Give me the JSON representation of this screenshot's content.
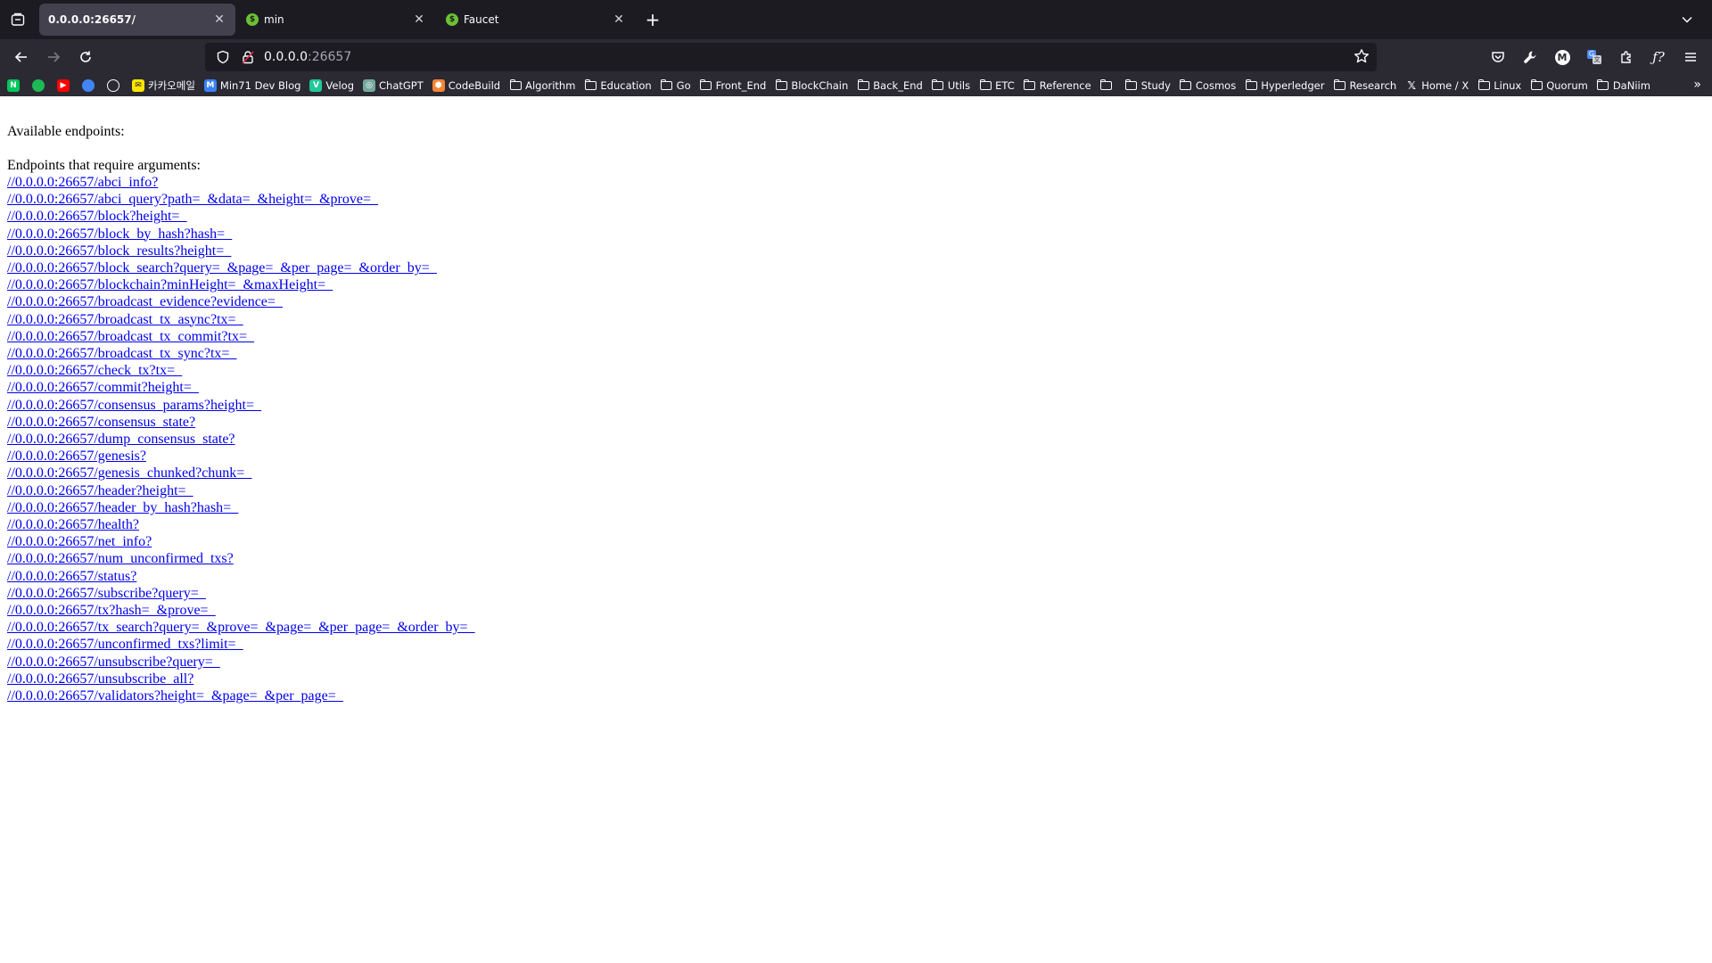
{
  "browser": {
    "tabs": [
      {
        "title": "0.0.0.0:26657/",
        "active": true
      },
      {
        "title": "min",
        "active": false
      },
      {
        "title": "Faucet",
        "active": false
      }
    ],
    "url": {
      "host": "0.0.0.0",
      "port": ":26657"
    },
    "bookmarks": [
      {
        "label": "",
        "icon": "naver-icon",
        "color": "#03c75a",
        "glyph": "N"
      },
      {
        "label": "",
        "icon": "spotify-icon",
        "color": "#1db954",
        "glyph": ""
      },
      {
        "label": "",
        "icon": "youtube-icon",
        "color": "#ff0000",
        "glyph": "▶"
      },
      {
        "label": "",
        "icon": "chrome-icon",
        "color": "#4285f4",
        "glyph": ""
      },
      {
        "label": "",
        "icon": "github-icon",
        "color": "#ffffff",
        "glyph": ""
      },
      {
        "label": "카카오메일",
        "icon": "kakao-mail-icon",
        "color": "#fee500",
        "glyph": "✉"
      },
      {
        "label": "Min71 Dev Blog",
        "icon": "blog-icon",
        "color": "#3b82f6",
        "glyph": "M"
      },
      {
        "label": "Velog",
        "icon": "velog-icon",
        "color": "#20c997",
        "glyph": "V"
      },
      {
        "label": "ChatGPT",
        "icon": "chatgpt-icon",
        "color": "#74aa9c",
        "glyph": "◎"
      },
      {
        "label": "CodeBuild",
        "icon": "codebuild-icon",
        "color": "#f58536",
        "glyph": "⬢"
      },
      {
        "label": "Algorithm",
        "icon": "folder-icon"
      },
      {
        "label": "Education",
        "icon": "folder-icon"
      },
      {
        "label": "Go",
        "icon": "folder-icon"
      },
      {
        "label": "Front_End",
        "icon": "folder-icon"
      },
      {
        "label": "BlockChain",
        "icon": "folder-icon"
      },
      {
        "label": "Back_End",
        "icon": "folder-icon"
      },
      {
        "label": "Utils",
        "icon": "folder-icon"
      },
      {
        "label": "ETC",
        "icon": "folder-icon"
      },
      {
        "label": "Reference",
        "icon": "folder-icon"
      },
      {
        "label": "",
        "icon": "folder-icon"
      },
      {
        "label": "Study",
        "icon": "folder-icon"
      },
      {
        "label": "Cosmos",
        "icon": "folder-icon"
      },
      {
        "label": "Hyperledger",
        "icon": "folder-icon"
      },
      {
        "label": "Research",
        "icon": "folder-icon"
      },
      {
        "label": "Home / X",
        "icon": "x-icon",
        "color": "#ffffff",
        "glyph": "𝕏"
      },
      {
        "label": "Linux",
        "icon": "folder-icon"
      },
      {
        "label": "Quorum",
        "icon": "folder-icon"
      },
      {
        "label": "DaNiim",
        "icon": "folder-icon"
      }
    ]
  },
  "page": {
    "available_label": "Available endpoints:",
    "require_label": "Endpoints that require arguments:",
    "endpoints": [
      "//0.0.0.0:26657/abci_info?",
      "//0.0.0.0:26657/abci_query?path=_&data=_&height=_&prove=_",
      "//0.0.0.0:26657/block?height=_",
      "//0.0.0.0:26657/block_by_hash?hash=_",
      "//0.0.0.0:26657/block_results?height=_",
      "//0.0.0.0:26657/block_search?query=_&page=_&per_page=_&order_by=_",
      "//0.0.0.0:26657/blockchain?minHeight=_&maxHeight=_",
      "//0.0.0.0:26657/broadcast_evidence?evidence=_",
      "//0.0.0.0:26657/broadcast_tx_async?tx=_",
      "//0.0.0.0:26657/broadcast_tx_commit?tx=_",
      "//0.0.0.0:26657/broadcast_tx_sync?tx=_",
      "//0.0.0.0:26657/check_tx?tx=_",
      "//0.0.0.0:26657/commit?height=_",
      "//0.0.0.0:26657/consensus_params?height=_",
      "//0.0.0.0:26657/consensus_state?",
      "//0.0.0.0:26657/dump_consensus_state?",
      "//0.0.0.0:26657/genesis?",
      "//0.0.0.0:26657/genesis_chunked?chunk=_",
      "//0.0.0.0:26657/header?height=_",
      "//0.0.0.0:26657/header_by_hash?hash=_",
      "//0.0.0.0:26657/health?",
      "//0.0.0.0:26657/net_info?",
      "//0.0.0.0:26657/num_unconfirmed_txs?",
      "//0.0.0.0:26657/status?",
      "//0.0.0.0:26657/subscribe?query=_",
      "//0.0.0.0:26657/tx?hash=_&prove=_",
      "//0.0.0.0:26657/tx_search?query=_&prove=_&page=_&per_page=_&order_by=_",
      "//0.0.0.0:26657/unconfirmed_txs?limit=_",
      "//0.0.0.0:26657/unsubscribe?query=_",
      "//0.0.0.0:26657/unsubscribe_all?",
      "//0.0.0.0:26657/validators?height=_&page=_&per_page=_"
    ]
  }
}
